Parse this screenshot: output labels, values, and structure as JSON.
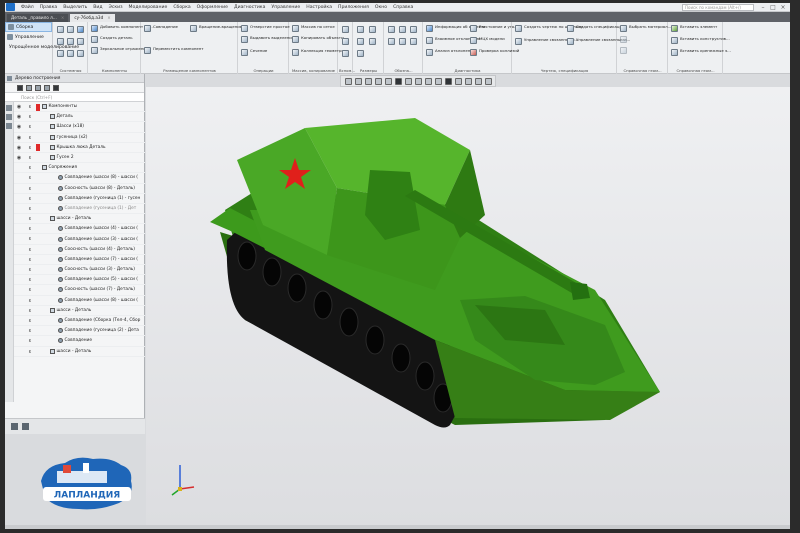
{
  "menu": {
    "items": [
      "Файл",
      "Правка",
      "Выделить",
      "Вид",
      "Эскиз",
      "Моделирование",
      "Сборка",
      "Оформление",
      "Диагностика",
      "Управление",
      "Настройка",
      "Приложения",
      "Окно",
      "Справка"
    ],
    "search_placeholder": "Поиск по командам (Alt+/)"
  },
  "tabs": [
    {
      "label": "Деталь _правило л..."
    },
    {
      "label": "су-76обд.a3d"
    }
  ],
  "modes": [
    "Сборка",
    "Управление",
    "Упрощённое моделирование"
  ],
  "ribbon": {
    "groups": [
      "Системная",
      "Компоненты",
      "Размещение компонентов",
      "Операции",
      "Массив, копирование",
      "Вспом...",
      "Размеры",
      "Обозна...",
      "Диагностика",
      "Чертеж, спецификация",
      "Справочная геом...",
      "Справочная геом..."
    ],
    "buttons": {
      "add_component": "Добавить компонент из...",
      "create_part": "Создать деталь",
      "mirror": "Зеркальное отражение",
      "move": "Переместить компонент",
      "coincidence": "Совпадение",
      "rotate": "Вращение-вращение",
      "hole": "Отверстие простое",
      "extrude": "Выдавить выделением",
      "section": "Сечение",
      "pattern": "Массив по сетке",
      "copy_objects": "Копировать объекты",
      "geometry_collection": "Коллекция геометрии",
      "info": "Информация об объекте",
      "distance": "Расстояние и угол",
      "mcx": "МЦХ модели",
      "interference": "Взаимное отклонение",
      "check_collisions": "Проверка коллизий",
      "analysis": "Анализ отклонений",
      "drawing_template": "Создать чертеж по шаблону",
      "associative": "Управление связанными...",
      "specification": "Создать спецификацию",
      "manage_linked": "Управление связанными...",
      "select_material": "Выбрать материал...",
      "insert_element": "Вставить элемент",
      "insert_fasteners": "Вставить конструктив...",
      "insert_fixing": "Вставить крепежные э..."
    }
  },
  "tree": {
    "title": "Дерево построения",
    "search_placeholder": "Поиск (Ctrl+F)",
    "rows": [
      {
        "level": 0,
        "label": "Компоненты",
        "flag": true,
        "eye": true
      },
      {
        "level": 1,
        "label": "Деталь",
        "flag": false,
        "eye": true
      },
      {
        "level": 1,
        "label": "Шасси (х18)",
        "flag": false,
        "eye": true
      },
      {
        "level": 1,
        "label": "гусеница (х2)",
        "flag": false,
        "eye": true
      },
      {
        "level": 1,
        "label": "Крышка люка Деталь",
        "flag": true,
        "eye": true
      },
      {
        "level": 1,
        "label": "Гусен 2",
        "flag": false,
        "eye": true
      },
      {
        "level": 0,
        "label": "Сопряжения",
        "flag": false,
        "eye": false
      },
      {
        "level": 2,
        "label": "Совпадение (шасси (8) - шасси (",
        "flag": false,
        "eye": false
      },
      {
        "level": 2,
        "label": "Соосность (шасси (8) - Деталь)",
        "flag": false,
        "eye": false
      },
      {
        "level": 2,
        "label": "Совпадение (гусеница (1) - гусен",
        "flag": false,
        "eye": false
      },
      {
        "level": 2,
        "label": "Совпадение (гусеница (1) - Дет",
        "flag": false,
        "eye": false,
        "dim": true
      },
      {
        "level": 1,
        "label": "шасси - Деталь",
        "flag": false,
        "eye": false
      },
      {
        "level": 2,
        "label": "Совпадение (шасси (4) - шасси (",
        "flag": false,
        "eye": false
      },
      {
        "level": 2,
        "label": "Совпадение (шасси (3) - шасси (",
        "flag": false,
        "eye": false
      },
      {
        "level": 2,
        "label": "Соосность (шасси (4) - Деталь)",
        "flag": false,
        "eye": false
      },
      {
        "level": 2,
        "label": "Совпадение (шасси (7) - шасси (",
        "flag": false,
        "eye": false
      },
      {
        "level": 2,
        "label": "Соосность (шасси (3) - Деталь)",
        "flag": false,
        "eye": false
      },
      {
        "level": 2,
        "label": "Совпадение (шасси (5) - шасси (",
        "flag": false,
        "eye": false
      },
      {
        "level": 2,
        "label": "Соосность (шасси (7) - Деталь)",
        "flag": false,
        "eye": false
      },
      {
        "level": 2,
        "label": "Совпадение (шасси (8) - шасси (",
        "flag": false,
        "eye": false
      },
      {
        "level": 1,
        "label": "шасси - Деталь",
        "flag": false,
        "eye": false
      },
      {
        "level": 2,
        "label": "Совпадение (Сборка (Тел-4, Сбор",
        "flag": false,
        "eye": false
      },
      {
        "level": 2,
        "label": "Совпадение (гусеница (2) - Дета",
        "flag": false,
        "eye": false
      },
      {
        "level": 2,
        "label": "Совпадение",
        "flag": false,
        "eye": false
      },
      {
        "level": 1,
        "label": "шасси - Деталь",
        "flag": false,
        "eye": false
      }
    ]
  },
  "logo": {
    "text": "ЛАПЛАНДИЯ"
  },
  "colors": {
    "hull": "#3f9b1e",
    "hull_dark": "#2d7a12",
    "star": "#e0201b",
    "track": "#1a1a1a",
    "accent": "#1e6fc8"
  }
}
